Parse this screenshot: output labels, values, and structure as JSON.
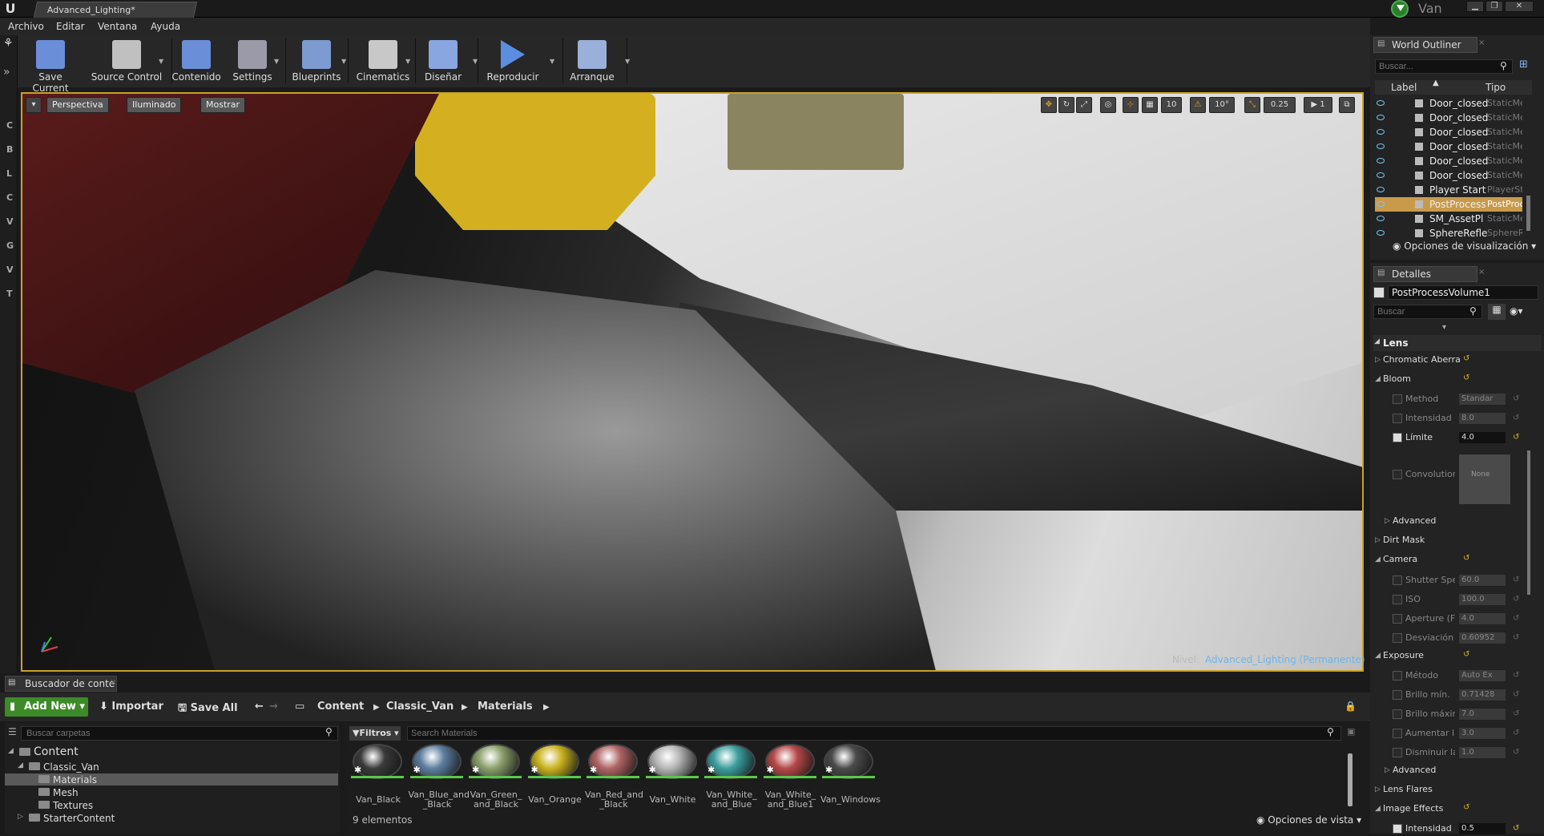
{
  "window": {
    "tab_title": "Advanced_Lighting*",
    "project": "Van",
    "logo": "U"
  },
  "menu": [
    "Archivo",
    "Editar",
    "Ventana",
    "Ayuda"
  ],
  "modes": [
    "C",
    "B",
    "L",
    "C",
    "V",
    "G",
    "V",
    "T"
  ],
  "toolbar": [
    {
      "label": "Save Current",
      "icon": "save-icon"
    },
    {
      "label": "Source Control",
      "icon": "source-control-icon"
    },
    {
      "label": "Contenido",
      "icon": "content-icon"
    },
    {
      "label": "Settings",
      "icon": "settings-icon"
    },
    {
      "label": "Blueprints",
      "icon": "blueprints-icon"
    },
    {
      "label": "Cinematics",
      "icon": "cinematics-icon"
    },
    {
      "label": "Diseñar",
      "icon": "build-icon"
    },
    {
      "label": "Reproducir",
      "icon": "play-icon"
    },
    {
      "label": "Arranque",
      "icon": "launch-icon"
    }
  ],
  "viewport": {
    "buttons": [
      "Perspectiva",
      "Iluminado",
      "Mostrar"
    ],
    "grid": "10",
    "rotation": "10°",
    "scale": "0.25",
    "camera_speed": "1",
    "level_label": "Nivel:",
    "level_name": "Advanced_Lighting (Permanente)"
  },
  "content_browser": {
    "tab": "Buscador de conte",
    "add_new": "Add New",
    "import": "Importar",
    "save_all": "Save All",
    "path": [
      "Content",
      "Classic_Van",
      "Materials"
    ],
    "folder_search_placeholder": "Buscar carpetas",
    "filters": "Filtros",
    "search_placeholder": "Search Materials",
    "tree": [
      {
        "label": "Content",
        "level": 0
      },
      {
        "label": "Classic_Van",
        "level": 1
      },
      {
        "label": "Materials",
        "level": 2,
        "selected": true
      },
      {
        "label": "Mesh",
        "level": 2
      },
      {
        "label": "Textures",
        "level": 2
      },
      {
        "label": "StarterContent",
        "level": 1
      }
    ],
    "assets": [
      {
        "line1": "Van_Black",
        "line2": "",
        "color": "#3a3a3a"
      },
      {
        "line1": "Van_Blue_and",
        "line2": "_Black",
        "color": "#5d7ea0"
      },
      {
        "line1": "Van_Green_",
        "line2": "and_Black",
        "color": "#8aa06a"
      },
      {
        "line1": "Van_Orange",
        "line2": "",
        "color": "#c9b21f"
      },
      {
        "line1": "Van_Red_and",
        "line2": "_Black",
        "color": "#b06464"
      },
      {
        "line1": "Van_White",
        "line2": "",
        "color": "#b5b5b5"
      },
      {
        "line1": "Van_White_",
        "line2": "and_Blue",
        "color": "#3c9e9e"
      },
      {
        "line1": "Van_White_",
        "line2": "and_Blue1",
        "color": "#b54848"
      },
      {
        "line1": "Van_Windows",
        "line2": "",
        "color": "#4a4a4a"
      }
    ],
    "count": "9 elementos",
    "view_options": "Opciones de vista"
  },
  "world_outliner": {
    "tab": "World Outliner",
    "search_placeholder": "Buscar...",
    "col_label": "Label",
    "col_type": "Tipo",
    "rows": [
      {
        "name": "Door_closed",
        "type": "StaticMe"
      },
      {
        "name": "Door_closed",
        "type": "StaticMe"
      },
      {
        "name": "Door_closed",
        "type": "StaticMe"
      },
      {
        "name": "Door_closed",
        "type": "StaticMe"
      },
      {
        "name": "Door_closed",
        "type": "StaticMe"
      },
      {
        "name": "Door_closed",
        "type": "StaticMe"
      },
      {
        "name": "Player Start",
        "type": "PlayerSt"
      },
      {
        "name": "PostProcess",
        "type": "PostProc",
        "selected": true
      },
      {
        "name": "SM_AssetPl",
        "type": "StaticMe"
      },
      {
        "name": "SphereRefle",
        "type": "SphereRe"
      }
    ],
    "view_options": "Opciones de visualización"
  },
  "details": {
    "tab": "Detalles",
    "object_name": "PostProcessVolume1",
    "search_placeholder": "Buscar",
    "section": "Lens",
    "items": [
      {
        "kind": "cat",
        "label": "Chromatic Aberra",
        "arrow": "▷"
      },
      {
        "kind": "cat",
        "label": "Bloom",
        "arrow": "◢"
      },
      {
        "kind": "prop",
        "label": "Method",
        "value": "Standar",
        "enabled": false,
        "checked": false
      },
      {
        "kind": "prop",
        "label": "Intensidad",
        "value": "8.0",
        "enabled": false,
        "checked": false
      },
      {
        "kind": "prop",
        "label": "Límite",
        "value": "4.0",
        "enabled": true,
        "checked": true
      },
      {
        "kind": "prop",
        "label": "Convolution",
        "value": "None",
        "enabled": false,
        "checked": false
      },
      {
        "kind": "cat",
        "label": "Advanced",
        "arrow": "▷"
      },
      {
        "kind": "cat",
        "label": "Dirt Mask",
        "arrow": "▷"
      },
      {
        "kind": "cat",
        "label": "Camera",
        "arrow": "◢"
      },
      {
        "kind": "prop",
        "label": "Shutter Spe",
        "value": "60.0",
        "enabled": false,
        "checked": false
      },
      {
        "kind": "prop",
        "label": "ISO",
        "value": "100.0",
        "enabled": false,
        "checked": false
      },
      {
        "kind": "prop",
        "label": "Aperture (F-",
        "value": "4.0",
        "enabled": false,
        "checked": false
      },
      {
        "kind": "prop",
        "label": "Desviación",
        "value": "0.60952",
        "enabled": false,
        "checked": false
      },
      {
        "kind": "cat",
        "label": "Exposure",
        "arrow": "◢"
      },
      {
        "kind": "prop",
        "label": "Método",
        "value": "Auto Ex",
        "enabled": false,
        "checked": false
      },
      {
        "kind": "prop",
        "label": "Brillo mín.",
        "value": "0.71428",
        "enabled": false,
        "checked": false
      },
      {
        "kind": "prop",
        "label": "Brillo máxim",
        "value": "7.0",
        "enabled": false,
        "checked": false
      },
      {
        "kind": "prop",
        "label": "Aumentar la",
        "value": "3.0",
        "enabled": false,
        "checked": false
      },
      {
        "kind": "prop",
        "label": "Disminuir la",
        "value": "1.0",
        "enabled": false,
        "checked": false
      },
      {
        "kind": "cat",
        "label": "Advanced",
        "arrow": "▷"
      },
      {
        "kind": "cat",
        "label": "Lens Flares",
        "arrow": "▷"
      },
      {
        "kind": "cat",
        "label": "Image Effects",
        "arrow": "◢"
      },
      {
        "kind": "prop",
        "label": "Intensidad d",
        "value": "0.5",
        "enabled": true,
        "checked": true
      }
    ]
  }
}
